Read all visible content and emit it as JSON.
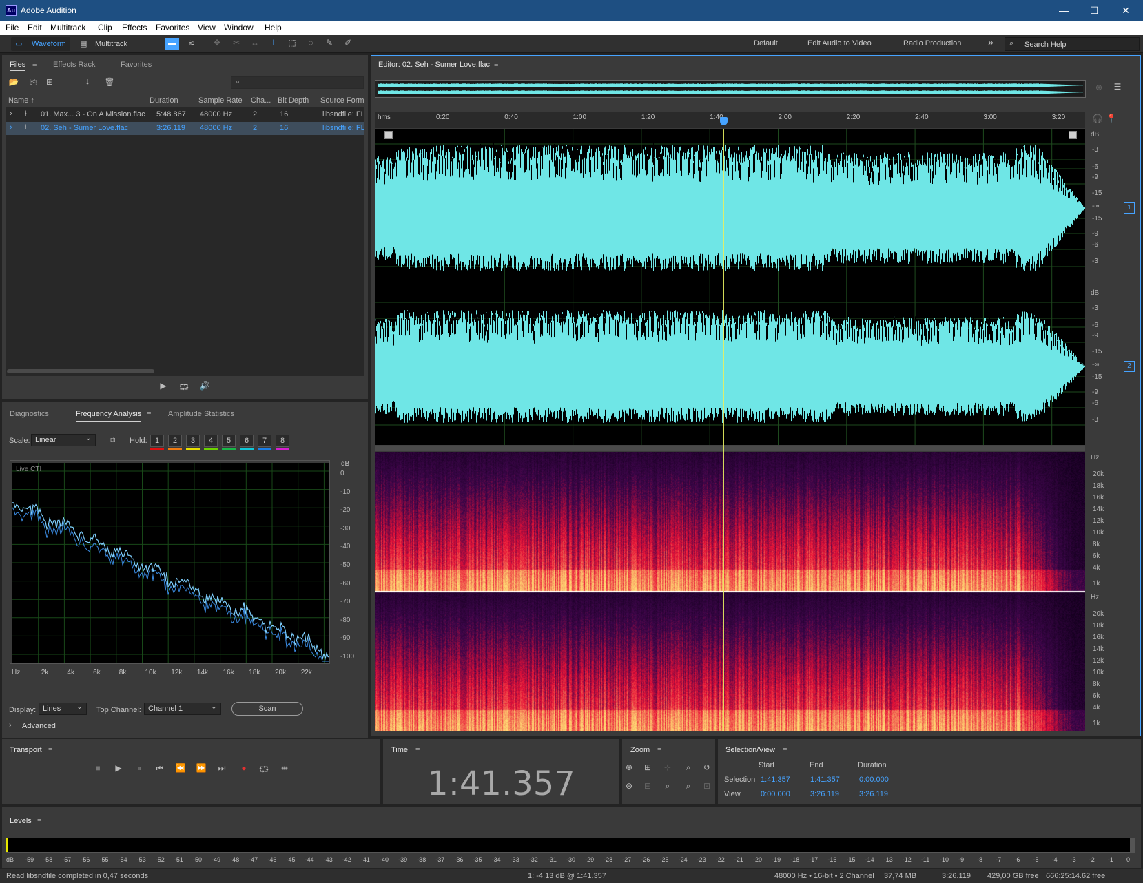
{
  "app": {
    "title": "Adobe Audition",
    "logo": "Au"
  },
  "window_controls": {
    "minimize": "—",
    "maximize": "☐",
    "close": "✕"
  },
  "menu": [
    "File",
    "Edit",
    "Multitrack",
    "Clip",
    "Effects",
    "Favorites",
    "View",
    "Window",
    "Help"
  ],
  "toolbar": {
    "waveform_label": "Waveform",
    "multitrack_label": "Multitrack",
    "workspaces": [
      "Default",
      "Edit Audio to Video",
      "Radio Production"
    ],
    "more": "»",
    "search_placeholder": "Search Help"
  },
  "files_panel": {
    "tabs": [
      "Files",
      "Effects Rack",
      "Favorites"
    ],
    "columns": [
      "Name ↑",
      "Duration",
      "Sample Rate",
      "Cha...",
      "Bit Depth",
      "Source Form..."
    ],
    "rows": [
      {
        "name": "01. Max... 3 - On A Mission.flac",
        "duration": "5:48.867",
        "rate": "48000 Hz",
        "ch": "2",
        "bits": "16",
        "source": "libsndfile: FL",
        "selected": false
      },
      {
        "name": "02. Seh - Sumer Love.flac",
        "duration": "3:26.119",
        "rate": "48000 Hz",
        "ch": "2",
        "bits": "16",
        "source": "libsndfile: FL",
        "selected": true
      }
    ]
  },
  "analysis_panel": {
    "tabs": [
      "Diagnostics",
      "Frequency Analysis",
      "Amplitude Statistics"
    ],
    "scale_label": "Scale:",
    "scale_value": "Linear",
    "hold_label": "Hold:",
    "holds": [
      "1",
      "2",
      "3",
      "4",
      "5",
      "6",
      "7",
      "8"
    ],
    "hold_colors": [
      "#e01010",
      "#f07b10",
      "#e8e000",
      "#6dd400",
      "#18b848",
      "#10c8d8",
      "#1a7fe8",
      "#d81fd0"
    ],
    "live_label": "Live CTI",
    "db_unit": "dB",
    "db_ticks": [
      "0",
      "-10",
      "-20",
      "-30",
      "-40",
      "-50",
      "-60",
      "-70",
      "-80",
      "-90",
      "-100"
    ],
    "hz_ticks": [
      "Hz",
      "2k",
      "4k",
      "6k",
      "8k",
      "10k",
      "12k",
      "14k",
      "16k",
      "18k",
      "20k",
      "22k"
    ],
    "display_label": "Display:",
    "display_value": "Lines",
    "top_channel_label": "Top Channel:",
    "top_channel_value": "Channel 1",
    "scan_label": "Scan",
    "advanced_label": "Advanced"
  },
  "editor": {
    "title": "Editor: 02. Seh - Sumer Love.flac",
    "time_ruler": [
      "hms",
      "0:20",
      "0:40",
      "1:00",
      "1:20",
      "1:40",
      "2:00",
      "2:20",
      "2:40",
      "3:00",
      "3:20"
    ],
    "db_unit": "dB",
    "db_ticks": [
      "-3",
      "-6",
      "-9",
      "-15",
      "-∞",
      "-15",
      "-9",
      "-6",
      "-3"
    ],
    "channels": [
      "1",
      "2"
    ],
    "hz_unit": "Hz",
    "hz_ticks": [
      "20k",
      "18k",
      "16k",
      "14k",
      "12k",
      "10k",
      "8k",
      "6k",
      "4k",
      "1k"
    ]
  },
  "transport": {
    "title": "Transport"
  },
  "time_panel": {
    "title": "Time",
    "value": "1:41.357"
  },
  "zoom_panel": {
    "title": "Zoom"
  },
  "selection_panel": {
    "title": "Selection/View",
    "headers": [
      "Start",
      "End",
      "Duration"
    ],
    "selection_label": "Selection",
    "selection": [
      "1:41.357",
      "1:41.357",
      "0:00.000"
    ],
    "view_label": "View",
    "view": [
      "0:00.000",
      "3:26.119",
      "3:26.119"
    ]
  },
  "levels": {
    "title": "Levels",
    "scale": [
      "dB",
      "-59",
      "-58",
      "-57",
      "-56",
      "-55",
      "-54",
      "-53",
      "-52",
      "-51",
      "-50",
      "-49",
      "-48",
      "-47",
      "-46",
      "-45",
      "-44",
      "-43",
      "-42",
      "-41",
      "-40",
      "-39",
      "-38",
      "-37",
      "-36",
      "-35",
      "-34",
      "-33",
      "-32",
      "-31",
      "-30",
      "-29",
      "-28",
      "-27",
      "-26",
      "-25",
      "-24",
      "-23",
      "-22",
      "-21",
      "-20",
      "-19",
      "-18",
      "-17",
      "-16",
      "-15",
      "-14",
      "-13",
      "-12",
      "-11",
      "-10",
      "-9",
      "-8",
      "-7",
      "-6",
      "-5",
      "-4",
      "-3",
      "-2",
      "-1",
      "0"
    ]
  },
  "status_bar": {
    "message": "Read libsndfile completed in 0,47 seconds",
    "cursor": "1: -4,13 dB @ 1:41.357",
    "format": "48000 Hz • 16-bit • 2 Channel",
    "size": "37,74 MB",
    "duration": "3:26.119",
    "free": "429,00 GB free",
    "free_time": "666:25:14.62 free"
  },
  "colors": {
    "accent": "#46a3ff",
    "waveform": "#6fe6e6",
    "playhead": "#e8f060",
    "titlebar": "#1e4f82"
  }
}
